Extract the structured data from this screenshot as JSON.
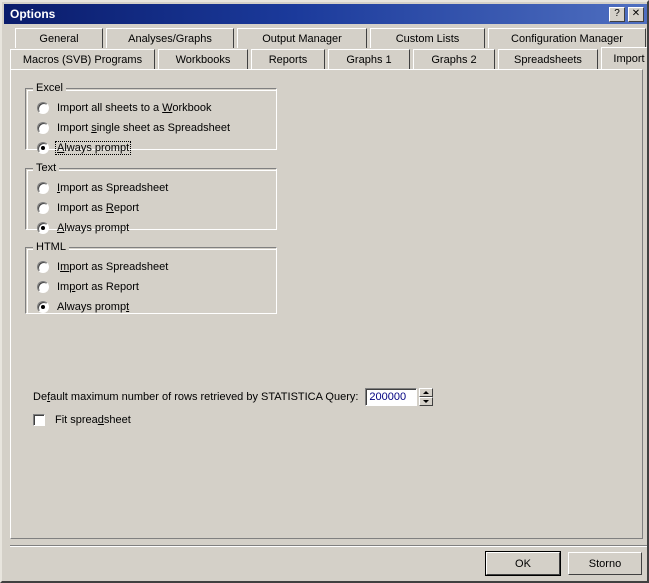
{
  "window": {
    "title": "Options",
    "help_button": "?",
    "close_button": "✕"
  },
  "tabs": {
    "row1": [
      {
        "label": "General",
        "selected": false
      },
      {
        "label": "Analyses/Graphs",
        "selected": false
      },
      {
        "label": "Output Manager",
        "selected": false
      },
      {
        "label": "Custom Lists",
        "selected": false
      },
      {
        "label": "Configuration Manager",
        "selected": false
      }
    ],
    "row2": [
      {
        "label": "Macros (SVB) Programs",
        "selected": false
      },
      {
        "label": "Workbooks",
        "selected": false
      },
      {
        "label": "Reports",
        "selected": false
      },
      {
        "label": "Graphs 1",
        "selected": false
      },
      {
        "label": "Graphs 2",
        "selected": false
      },
      {
        "label": "Spreadsheets",
        "selected": false
      },
      {
        "label": "Import",
        "selected": true
      }
    ]
  },
  "groups": {
    "excel": {
      "title": "Excel",
      "options": [
        {
          "label": "Import all sheets to a Workbook",
          "selected": false,
          "focused": false
        },
        {
          "label": "Import single sheet as Spreadsheet",
          "selected": false,
          "focused": false
        },
        {
          "label": "Always prompt",
          "selected": true,
          "focused": true
        }
      ]
    },
    "text": {
      "title": "Text",
      "options": [
        {
          "label": "Import as Spreadsheet",
          "selected": false,
          "focused": false
        },
        {
          "label": "Import as Report",
          "selected": false,
          "focused": false
        },
        {
          "label": "Always prompt",
          "selected": true,
          "focused": false
        }
      ]
    },
    "html": {
      "title": "HTML",
      "options": [
        {
          "label": "Import as Spreadsheet",
          "selected": false,
          "focused": false
        },
        {
          "label": "Import as Report",
          "selected": false,
          "focused": false
        },
        {
          "label": "Always prompt",
          "selected": true,
          "focused": false
        }
      ]
    }
  },
  "rows_setting": {
    "label": "Default maximum number of rows retrieved by STATISTICA Query:",
    "value": "200000",
    "spinner_up_icon": "arrow-up-icon",
    "spinner_down_icon": "arrow-down-icon",
    "value_color": "#000080"
  },
  "fit_spreadsheet": {
    "label": "Fit spreadsheet",
    "checked": false
  },
  "buttons": {
    "ok": "OK",
    "cancel": "Storno"
  }
}
